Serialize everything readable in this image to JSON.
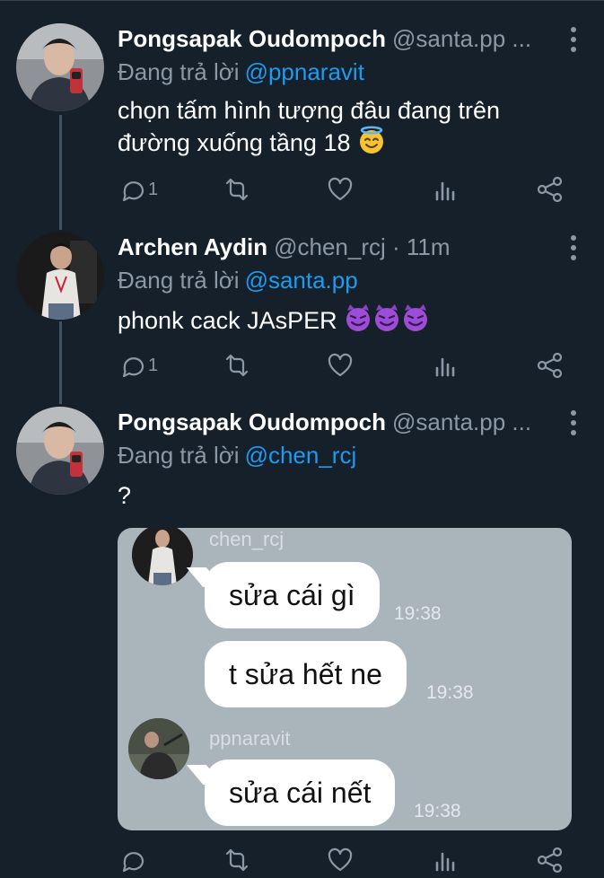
{
  "tweets": [
    {
      "name": "Pongsapak Oudompoch",
      "handle": "@santa.pp ...",
      "reply_prefix": "Đang trả lời",
      "reply_to": "@ppnaravit",
      "text": "chọn tấm hình tượng đâu đang trên đường xuống tầng 18",
      "emoji": "smiling-face-with-halo",
      "reply_count": "1"
    },
    {
      "name": "Archen Aydin",
      "handle": "@chen_rcj · 11m",
      "reply_prefix": "Đang trả lời",
      "reply_to": "@santa.pp",
      "text": "phonk cack JAsPER",
      "emoji": "smiling-face-with-horns",
      "reply_count": "1"
    },
    {
      "name": "Pongsapak Oudompoch",
      "handle": "@santa.pp ...",
      "reply_prefix": "Đang trả lời",
      "reply_to": "@chen_rcj",
      "text": "?",
      "reply_count": ""
    }
  ],
  "chat": {
    "messages": [
      {
        "sender": "chen_rcj",
        "text": "sửa cái gì",
        "time": "19:38"
      },
      {
        "sender": "",
        "text": "t sửa hết ne",
        "time": "19:38"
      },
      {
        "sender": "ppnaravit",
        "text": "sửa cái nết",
        "time": "19:38"
      }
    ]
  },
  "icons": [
    "reply-icon",
    "retweet-icon",
    "like-icon",
    "analytics-icon",
    "share-icon",
    "more-icon"
  ],
  "colors": {
    "background": "#15202b",
    "secondary_text": "#8b98a5",
    "mention": "#1d9bf0",
    "thread_line": "#3d5466",
    "chat_background": "#a9b4bb"
  }
}
